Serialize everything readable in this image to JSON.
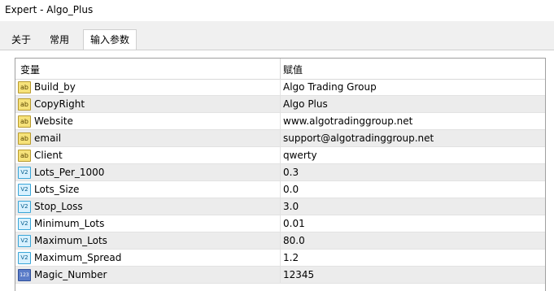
{
  "window": {
    "title": "Expert - Algo_Plus"
  },
  "tabs": [
    {
      "label": "关于"
    },
    {
      "label": "常用"
    },
    {
      "label": "输入参数",
      "active": true
    }
  ],
  "table": {
    "headers": {
      "variable": "变量",
      "value": "赋值"
    },
    "rows": [
      {
        "icon": "string-icon",
        "icon_text": "ab",
        "name": "Build_by",
        "value": "Algo Trading Group"
      },
      {
        "icon": "string-icon",
        "icon_text": "ab",
        "name": "CopyRight",
        "value": "Algo Plus"
      },
      {
        "icon": "string-icon",
        "icon_text": "ab",
        "name": "Website",
        "value": "www.algotradinggroup.net"
      },
      {
        "icon": "string-icon",
        "icon_text": "ab",
        "name": "email",
        "value": "support@algotradinggroup.net"
      },
      {
        "icon": "string-icon",
        "icon_text": "ab",
        "name": "Client",
        "value": "qwerty"
      },
      {
        "icon": "double-icon",
        "icon_text": "V2",
        "name": "Lots_Per_1000",
        "value": "0.3"
      },
      {
        "icon": "double-icon",
        "icon_text": "V2",
        "name": "Lots_Size",
        "value": "0.0"
      },
      {
        "icon": "double-icon",
        "icon_text": "V2",
        "name": "Stop_Loss",
        "value": "3.0"
      },
      {
        "icon": "double-icon",
        "icon_text": "V2",
        "name": "Minimum_Lots",
        "value": "0.01"
      },
      {
        "icon": "double-icon",
        "icon_text": "V2",
        "name": "Maximum_Lots",
        "value": "80.0"
      },
      {
        "icon": "double-icon",
        "icon_text": "V2",
        "name": "Maximum_Spread",
        "value": "1.2"
      },
      {
        "icon": "integer-icon",
        "icon_text": "123",
        "name": "Magic_Number",
        "value": "12345"
      }
    ]
  },
  "colors": {
    "string_icon": "#f6e27a",
    "double_icon": "#d8f1ff",
    "integer_icon": "#5a7cc8",
    "alt_row": "#ececec"
  }
}
